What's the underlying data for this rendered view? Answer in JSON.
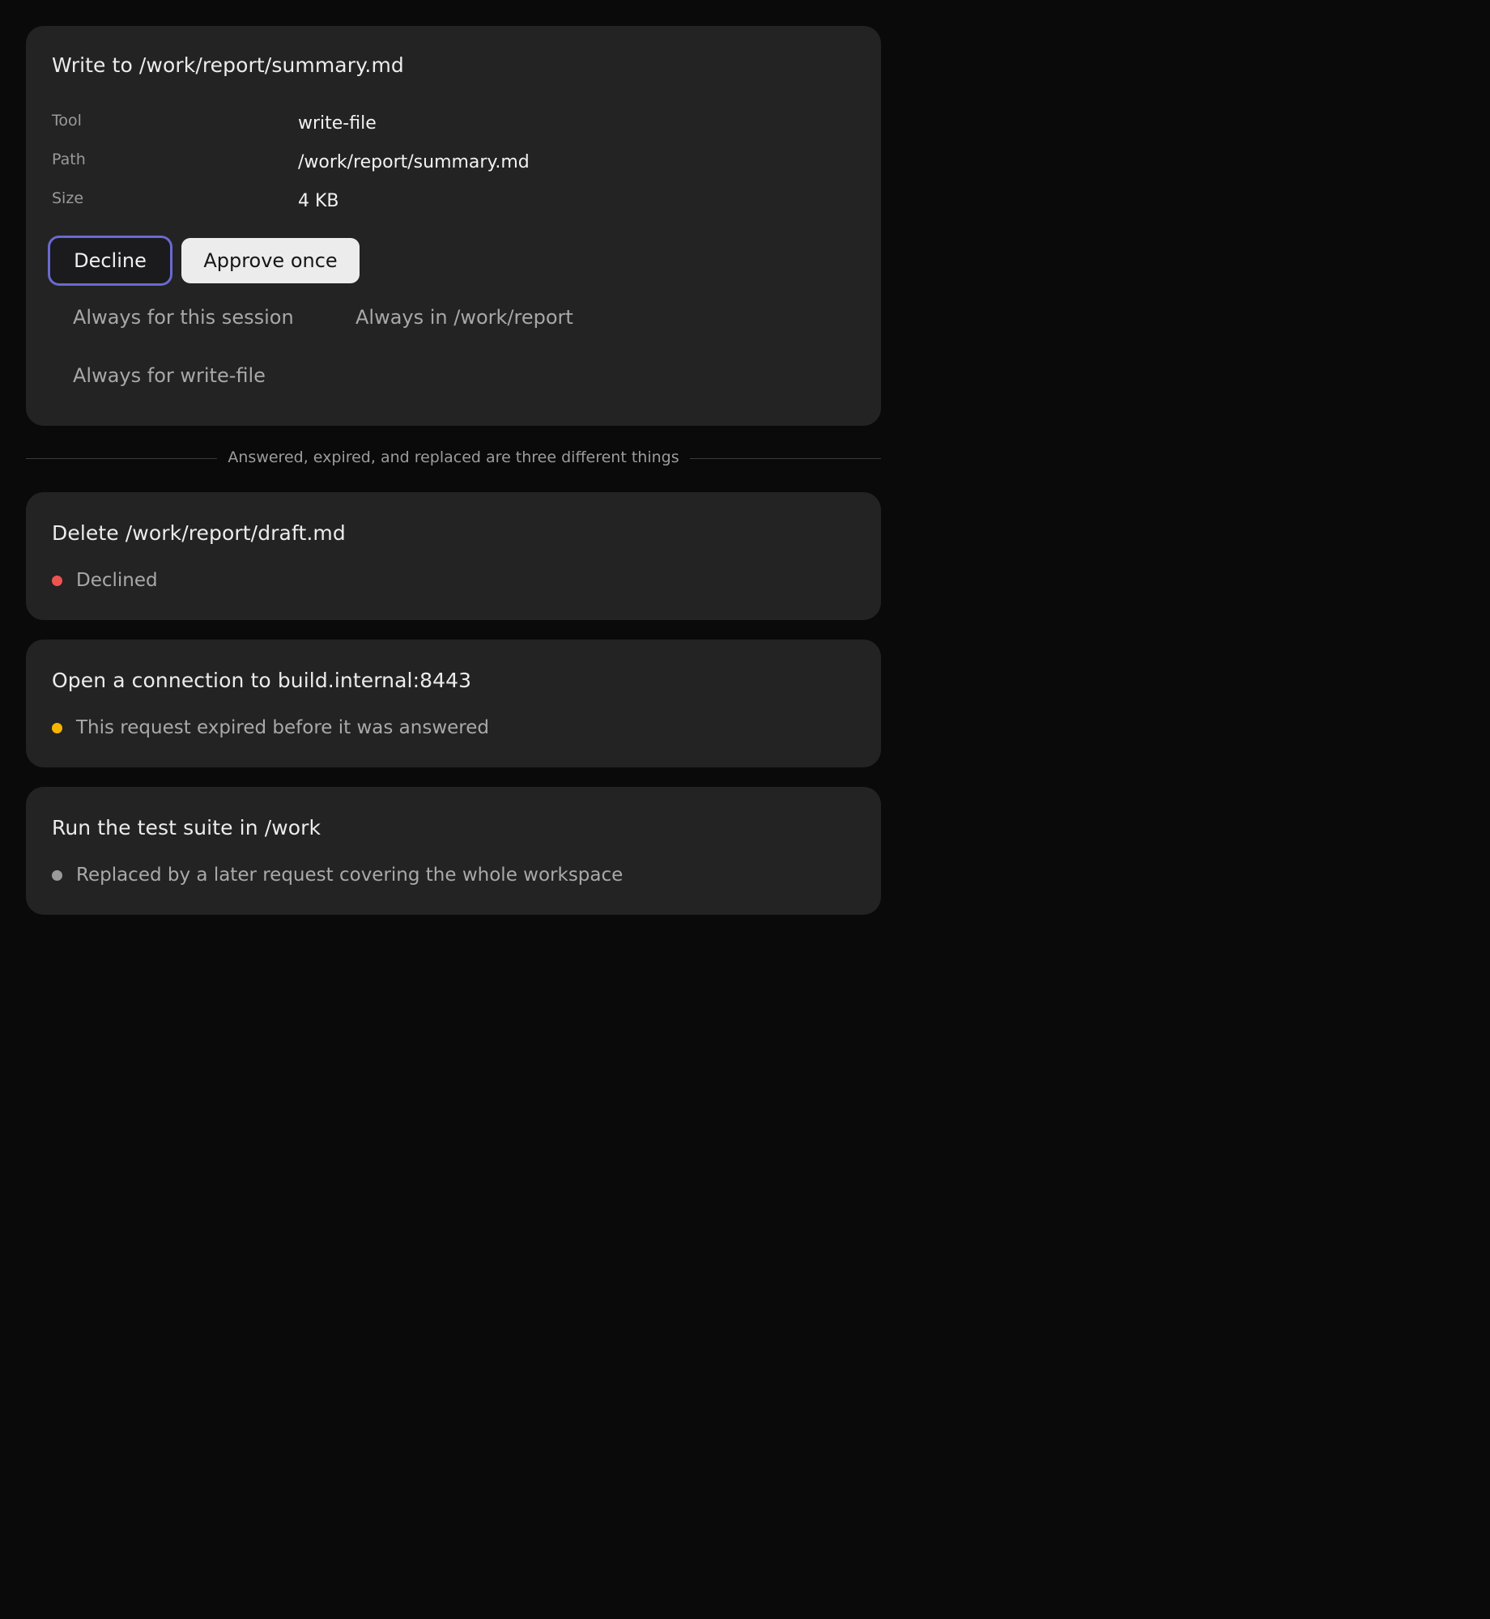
{
  "request": {
    "title": "Write to /work/report/summary.md",
    "details": [
      {
        "label": "Tool",
        "value": "write-file"
      },
      {
        "label": "Path",
        "value": "/work/report/summary.md"
      },
      {
        "label": "Size",
        "value": "4 KB"
      }
    ],
    "decline_label": "Decline",
    "approve_label": "Approve once",
    "options": [
      "Always for this session",
      "Always in /work/report",
      "Always for write-file"
    ]
  },
  "divider_text": "Answered, expired, and replaced are three different things",
  "history": [
    {
      "title": "Delete /work/report/draft.md",
      "status": "Declined",
      "status_color": "#ef5350"
    },
    {
      "title": "Open a connection to build.internal:8443",
      "status": "This request expired before it was answered",
      "status_color": "#f5b400"
    },
    {
      "title": "Run the test suite in /work",
      "status": "Replaced by a later request covering the whole workspace",
      "status_color": "#9a9a9a"
    }
  ]
}
